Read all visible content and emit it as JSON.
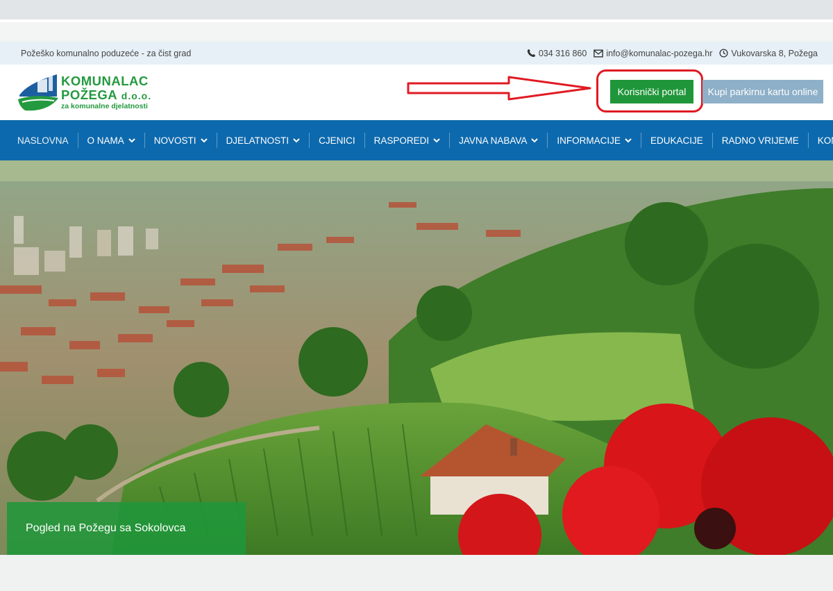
{
  "topbar": {
    "tagline": "Požeško komunalno poduzeće - za čist grad",
    "phone": "034 316 860",
    "email": "info@komunalac-pozega.hr",
    "address": "Vukovarska 8, Požega",
    "icons": [
      "phone-icon",
      "envelope-icon",
      "clock-icon"
    ]
  },
  "logo": {
    "line1": "KOMUNALAC",
    "line2": "POŽEGA",
    "line2_suffix": "d.o.o.",
    "line3": "za komunalne djelatnosti",
    "brand_color": "#239a3f"
  },
  "header": {
    "portal_label": "Korisnički portal",
    "parking_label": "Kupi parkirnu kartu online",
    "annotation_color": "#e01a22"
  },
  "nav": {
    "bg_color": "#0d69ad",
    "items": [
      {
        "label": "NASLOVNA",
        "dropdown": false
      },
      {
        "label": "O NAMA",
        "dropdown": true
      },
      {
        "label": "NOVOSTI",
        "dropdown": true
      },
      {
        "label": "DJELATNOSTI",
        "dropdown": true
      },
      {
        "label": "CJENICI",
        "dropdown": false
      },
      {
        "label": "RASPOREDI",
        "dropdown": true
      },
      {
        "label": "JAVNA NABAVA",
        "dropdown": true
      },
      {
        "label": "INFORMACIJE",
        "dropdown": true
      },
      {
        "label": "EDUKACIJE",
        "dropdown": false
      },
      {
        "label": "RADNO VRIJEME",
        "dropdown": false
      },
      {
        "label": "KONTAKT",
        "dropdown": false
      }
    ]
  },
  "hero": {
    "caption": "Pogled na Požegu sa Sokolovca"
  }
}
